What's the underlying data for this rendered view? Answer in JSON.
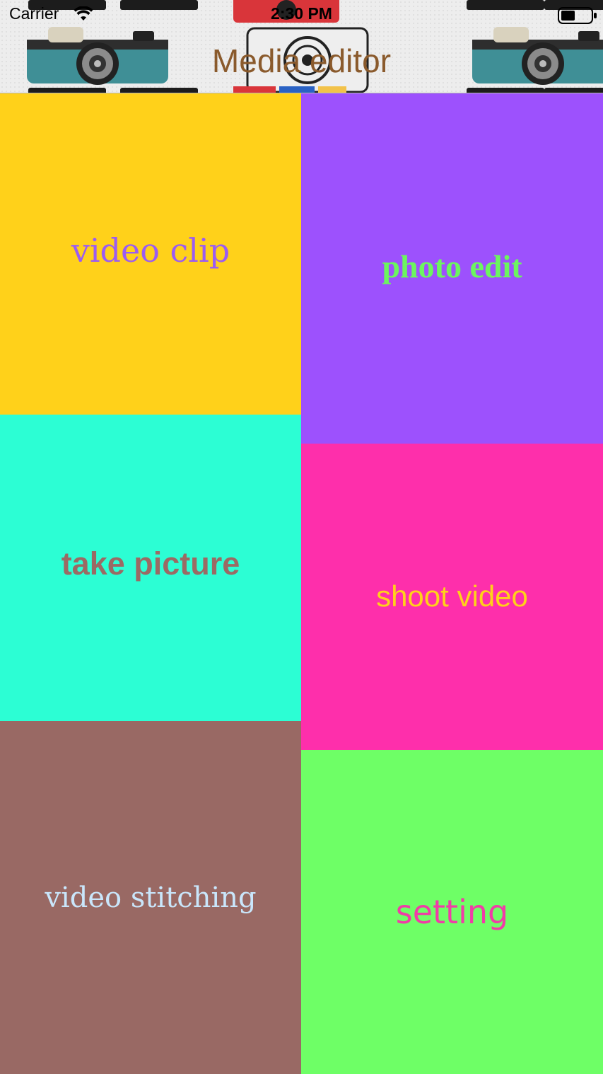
{
  "status_bar": {
    "carrier": "Carrier",
    "time": "2:30 PM",
    "wifi_icon": "wifi-icon",
    "battery_icon": "battery-icon"
  },
  "nav": {
    "title": "Media editor",
    "background": "camera-pattern"
  },
  "tiles": [
    {
      "label": "video clip",
      "background": "#ffd11a",
      "text_color": "#9b5cf2"
    },
    {
      "label": "photo edit",
      "background": "#9d51fd",
      "text_color": "#6cf55f"
    },
    {
      "label": "take picture",
      "background": "#2cfed4",
      "text_color": "#9b6a64"
    },
    {
      "label": "shoot video",
      "background": "#fe2fab",
      "text_color": "#ffd11a"
    },
    {
      "label": "video stitching",
      "background": "#996964",
      "text_color": "#c9e6fb"
    },
    {
      "label": "setting",
      "background": "#6eff66",
      "text_color": "#f03ca7"
    }
  ]
}
